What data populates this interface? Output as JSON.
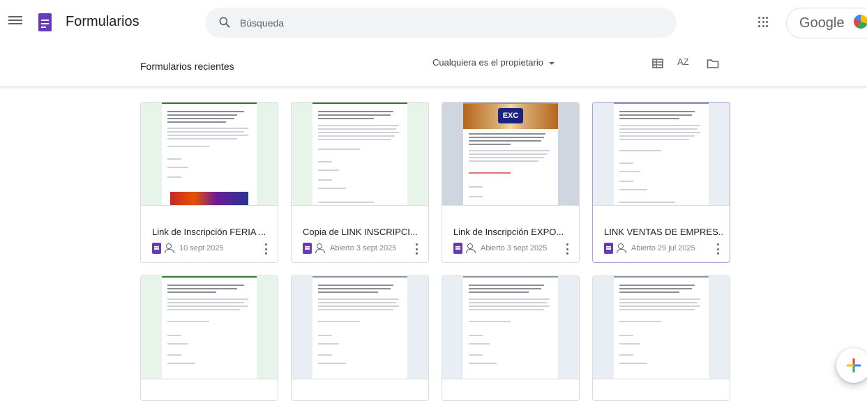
{
  "app": {
    "title": "Formularios"
  },
  "search": {
    "placeholder": "Búsqueda"
  },
  "account": {
    "label": "Google"
  },
  "toolbar": {
    "recent_title": "Formularios recientes",
    "owner_filter": "Cualquiera es el propietario",
    "sort_label": "AZ"
  },
  "forms_row1": [
    {
      "title": "Link de Inscripción FERIA ...",
      "date": "10 sept 2025",
      "shared": false,
      "thumb": "green-banner"
    },
    {
      "title": "Copia de LINK INSCRIPCI...",
      "date": "Abierto 3 sept 2025",
      "shared": true,
      "thumb": "green"
    },
    {
      "title": "Link de Inscripción EXPO...",
      "date": "Abierto 3 sept 2025",
      "shared": true,
      "thumb": "grey-header"
    },
    {
      "title": "LINK VENTAS DE EMPRES...",
      "date": "Abierto 29 jul 2025",
      "shared": true,
      "thumb": "blue"
    }
  ],
  "colors": {
    "forms_purple": "#673ab7",
    "accent_green": "#2e7d32"
  }
}
